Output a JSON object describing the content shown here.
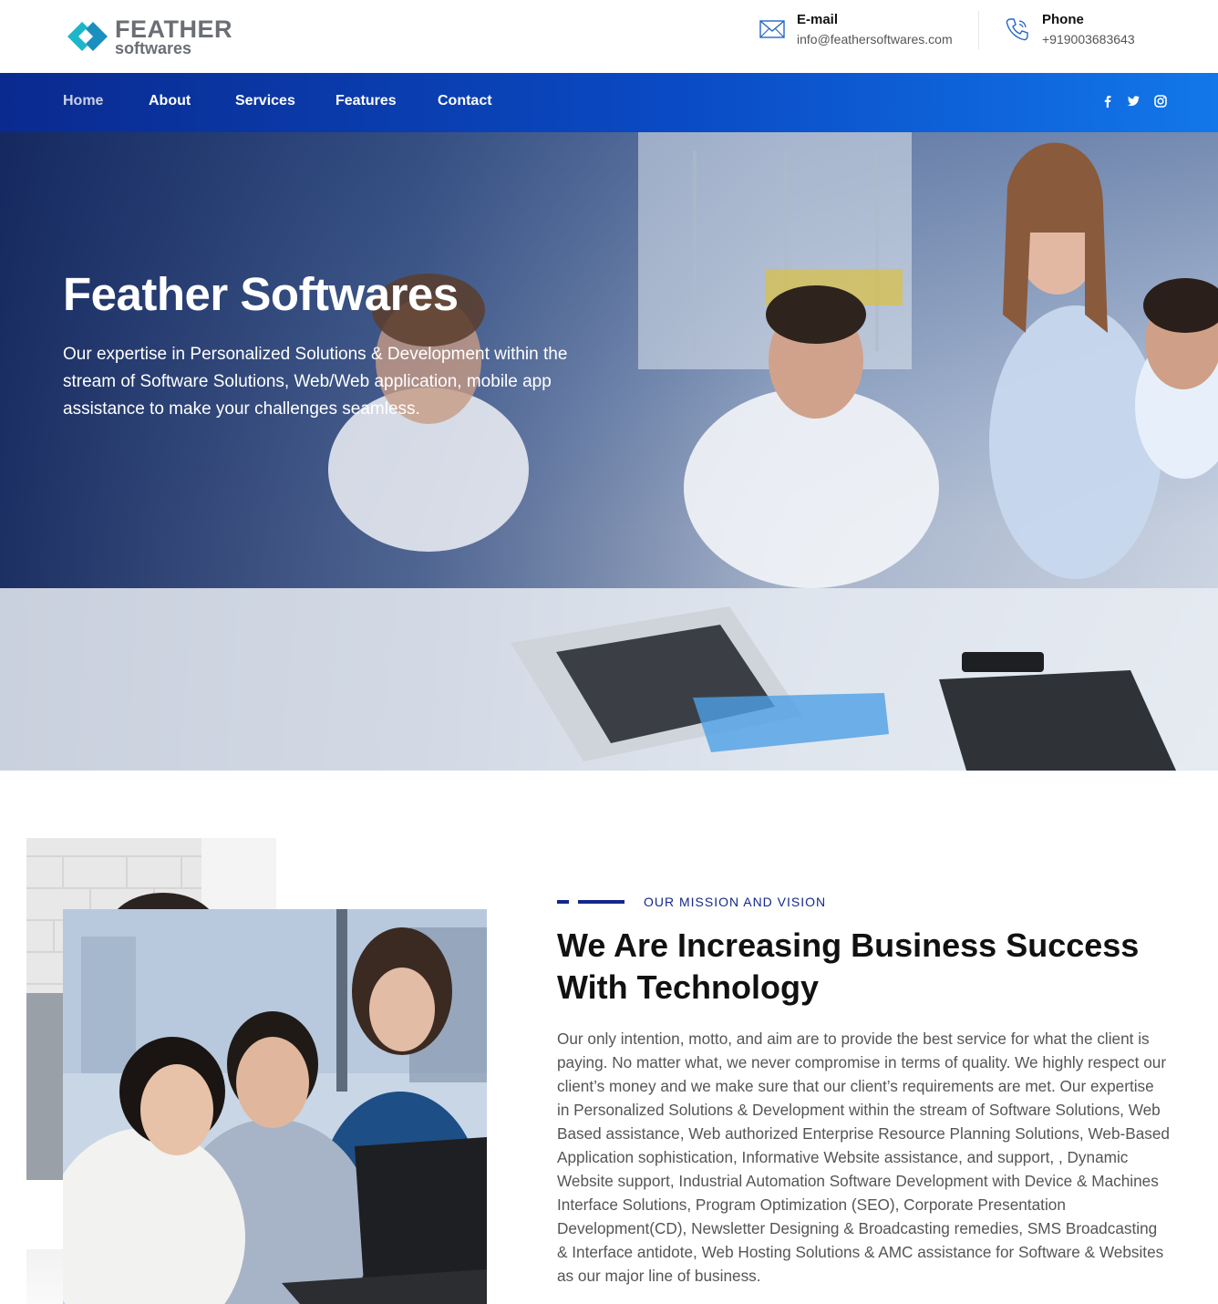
{
  "brand": {
    "name": "FEATHER",
    "sub": "softwares",
    "colors": {
      "logo_cyan": "#1bb7c9",
      "logo_grey": "#6b6f75",
      "nav_start": "#0a2a8f",
      "nav_end": "#1277ea",
      "accent": "#13288a"
    }
  },
  "header": {
    "email": {
      "label": "E-mail",
      "value": "info@feathersoftwares.com",
      "icon": "envelope-icon"
    },
    "phone": {
      "label": "Phone",
      "value": "+919003683643",
      "icon": "phone-icon"
    }
  },
  "nav": {
    "items": [
      {
        "label": "Home",
        "active": true
      },
      {
        "label": "About"
      },
      {
        "label": "Services"
      },
      {
        "label": "Features"
      },
      {
        "label": "Contact"
      }
    ],
    "social": [
      "facebook-icon",
      "twitter-icon",
      "instagram-icon"
    ]
  },
  "hero": {
    "title": "Feather Softwares",
    "description": "Our expertise in Personalized Solutions & Development within the stream of Software Solutions, Web/Web application, mobile app assistance to make your challenges seamless."
  },
  "mission": {
    "tag": "OUR MISSION AND VISION",
    "title": "We Are Increasing Business Success With Technology",
    "body": "Our only intention, motto, and aim are to provide the best service for what the client is paying. No matter what, we never compromise in terms of quality. We highly respect our client’s money and we make sure that our client’s requirements are met. Our expertise in Personalized Solutions & Development within the stream of Software Solutions, Web Based assistance, Web authorized Enterprise Resource Planning Solutions, Web-Based Application sophistication, Informative Website assistance, and support, , Dynamic Website support, Industrial Automation Software Development with Device & Machines Interface Solutions, Program Optimization (SEO), Corporate Presentation Development(CD), Newsletter Designing & Broadcasting remedies, SMS Broadcasting & Interface antidote, Web Hosting Solutions & AMC assistance for Software & Websites as our major line of business."
  }
}
